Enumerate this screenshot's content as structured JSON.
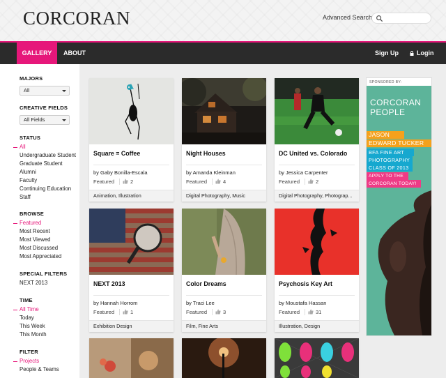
{
  "header": {
    "logo": "CORCORAN",
    "advanced_search": "Advanced Search",
    "search_placeholder": ""
  },
  "nav": {
    "tabs": [
      {
        "label": "GALLERY",
        "active": true
      },
      {
        "label": "ABOUT",
        "active": false
      }
    ],
    "signup": "Sign Up",
    "login": "Login"
  },
  "sidebar": {
    "majors": {
      "title": "MAJORS",
      "selected": "All"
    },
    "creative_fields": {
      "title": "CREATIVE FIELDS",
      "selected": "All Fields"
    },
    "status": {
      "title": "STATUS",
      "items": [
        "All",
        "Undergraduate Student",
        "Graduate Student",
        "Alumni",
        "Faculty",
        "Continuing Education",
        "Staff"
      ],
      "active": 0
    },
    "browse": {
      "title": "BROWSE",
      "items": [
        "Featured",
        "Most Recent",
        "Most Viewed",
        "Most Discussed",
        "Most Appreciated"
      ],
      "active": 0
    },
    "special_filters": {
      "title": "SPECIAL FILTERS",
      "items": [
        "NEXT 2013"
      ]
    },
    "time": {
      "title": "TIME",
      "items": [
        "All Time",
        "Today",
        "This Week",
        "This Month"
      ],
      "active": 0
    },
    "filter": {
      "title": "FILTER",
      "items": [
        "Projects",
        "People & Teams"
      ],
      "active": 0
    }
  },
  "cards": [
    {
      "title": "Square = Coffee",
      "author": "by Gaby Bonilla-Escala",
      "featured": "Featured",
      "likes": "2",
      "fields": "Animation, Illustration"
    },
    {
      "title": "Night Houses",
      "author": "by Amanda Kleinman",
      "featured": "Featured",
      "likes": "4",
      "fields": "Digital Photography, Music"
    },
    {
      "title": "DC United vs. Colorado",
      "author": "by Jessica Carpenter",
      "featured": "Featured",
      "likes": "2",
      "fields": "Digital Photography, Photograp..."
    },
    {
      "title": "NEXT 2013",
      "author": "by Hannah Horrom",
      "featured": "Featured",
      "likes": "1",
      "fields": "Exhibition Design"
    },
    {
      "title": "Color Dreams",
      "author": "by Traci Lee",
      "featured": "Featured",
      "likes": "3",
      "fields": "Film, Fine Arts"
    },
    {
      "title": "Psychosis Key Art",
      "author": "by Moustafa Hassan",
      "featured": "Featured",
      "likes": "31",
      "fields": "Illustration, Design"
    }
  ],
  "ad": {
    "sponsored": "SPONSORED BY:",
    "brand_line1": "CORCORAN",
    "brand_line2": "PEOPLE",
    "lines": [
      "JASON",
      "EDWARD TUCKER",
      "BFA FINE ART",
      "PHOTOGRAPHY",
      "CLASS OF 2013",
      "APPLY TO THE",
      "CORCORAN TODAY!"
    ]
  },
  "colors": {
    "accent": "#e6177a",
    "nav_bg": "#2b2b2b",
    "ad_green": "#5db49a",
    "ad_orange": "#f5a11c",
    "ad_cyan": "#16a8cf",
    "ad_pink": "#ef3a86"
  }
}
